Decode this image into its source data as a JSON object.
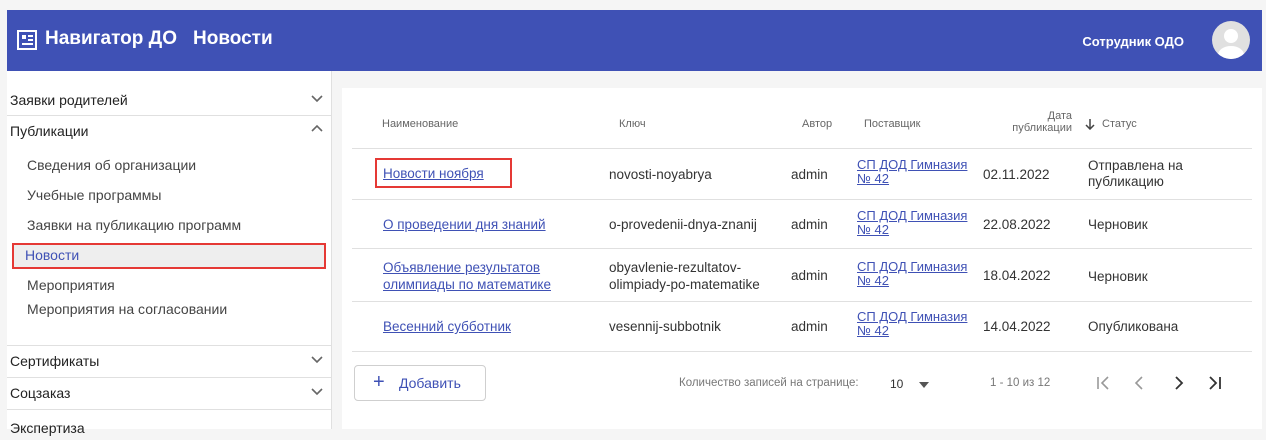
{
  "header": {
    "app_name": "Навигатор ДО",
    "page_title": "Новости",
    "user_name": "Сотрудник ОДО",
    "color": "#3f51b5"
  },
  "sidebar": {
    "sections": [
      {
        "label": "Заявки родителей",
        "state": "collapsed"
      },
      {
        "label": "Публикации",
        "state": "expanded"
      },
      {
        "label": "Сертификаты",
        "state": "collapsed"
      },
      {
        "label": "Соцзаказ",
        "state": "collapsed"
      },
      {
        "label": "Экспертиза",
        "state": "collapsed"
      }
    ],
    "publications_items": [
      "Сведения об организации",
      "Учебные программы",
      "Заявки на публикацию программ",
      "Новости",
      "Мероприятия",
      "Мероприятия на согласовании"
    ],
    "active_item": "Новости"
  },
  "table": {
    "columns": {
      "name": "Наименование",
      "key": "Ключ",
      "author": "Автор",
      "supplier": "Поставщик",
      "date_line1": "Дата",
      "date_line2": "публикации",
      "status": "Статус"
    },
    "sorted_column": "Статус",
    "rows": [
      {
        "name": "Новости ноября",
        "key": "novosti-noyabrya",
        "author": "admin",
        "supplier_line1": "СП ДОД Гимназия",
        "supplier_line2": "№ 42",
        "date": "02.11.2022",
        "status_line1": "Отправлена на",
        "status_line2": "публикацию"
      },
      {
        "name": "О проведении дня знаний",
        "key": "o-provedenii-dnya-znanij",
        "author": "admin",
        "supplier_line1": "СП ДОД Гимназия",
        "supplier_line2": "№ 42",
        "date": "22.08.2022",
        "status": "Черновик"
      },
      {
        "name_line1": "Объявление результатов",
        "name_line2": "олимпиады по математике",
        "key_line1": "obyavlenie-rezultatov-",
        "key_line2": "olimpiady-po-matematike",
        "author": "admin",
        "supplier_line1": "СП ДОД Гимназия",
        "supplier_line2": "№ 42",
        "date": "18.04.2022",
        "status": "Черновик"
      },
      {
        "name": "Весенний субботник",
        "key": "vesennij-subbotnik",
        "author": "admin",
        "supplier_line1": "СП ДОД Гимназия",
        "supplier_line2": "№ 42",
        "date": "14.04.2022",
        "status": "Опубликована"
      }
    ]
  },
  "footer": {
    "add_label": "Добавить",
    "rows_per_page_label": "Количество записей на странице:",
    "rows_per_page_value": "10",
    "range_text": "1 - 10 из 12"
  }
}
